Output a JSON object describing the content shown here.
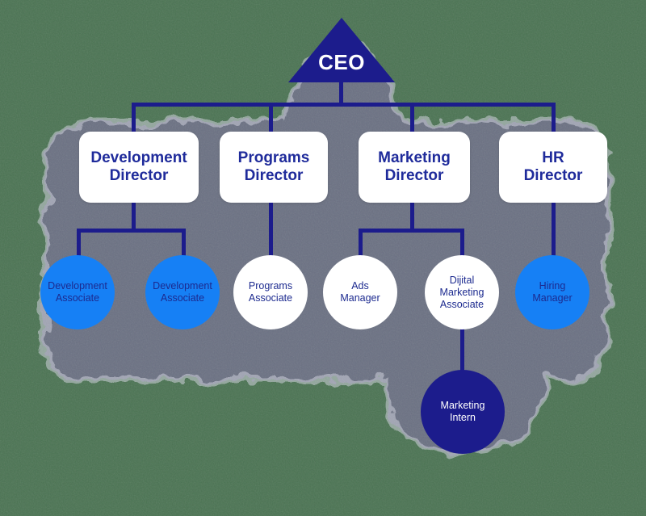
{
  "palette": {
    "navy": "#1c1c8c",
    "bright_blue": "#1680f5",
    "white": "#ffffff",
    "text_navy": "#1c2a8f",
    "background_green": "#4a7352",
    "cloud_gray": "#6d6f87"
  },
  "chart_data": {
    "type": "diagram",
    "title": "Organizational Chart",
    "nodes": [
      {
        "id": "ceo",
        "label": "CEO",
        "shape": "triangle",
        "fill": "#1c1c8c",
        "text_color": "#ffffff",
        "level": 0
      },
      {
        "id": "dev_dir",
        "label": "Development\nDirector",
        "shape": "rounded-rect",
        "fill": "#ffffff",
        "text_color": "#1f2b9b",
        "level": 1
      },
      {
        "id": "prog_dir",
        "label": "Programs\nDirector",
        "shape": "rounded-rect",
        "fill": "#ffffff",
        "text_color": "#1f2b9b",
        "level": 1
      },
      {
        "id": "mkt_dir",
        "label": "Marketing\nDirector",
        "shape": "rounded-rect",
        "fill": "#ffffff",
        "text_color": "#1f2b9b",
        "level": 1
      },
      {
        "id": "hr_dir",
        "label": "HR\nDirector",
        "shape": "rounded-rect",
        "fill": "#ffffff",
        "text_color": "#1f2b9b",
        "level": 1
      },
      {
        "id": "dev_a1",
        "label": "Development\nAssociate",
        "shape": "circle",
        "fill": "#1680f5",
        "text_color": "#1c2a8f",
        "level": 2
      },
      {
        "id": "dev_a2",
        "label": "Development\nAssociate",
        "shape": "circle",
        "fill": "#1680f5",
        "text_color": "#1c2a8f",
        "level": 2
      },
      {
        "id": "prog_a",
        "label": "Programs\nAssociate",
        "shape": "circle",
        "fill": "#ffffff",
        "text_color": "#1c2a8f",
        "level": 2
      },
      {
        "id": "ads_mgr",
        "label": "Ads\nManager",
        "shape": "circle",
        "fill": "#ffffff",
        "text_color": "#1c2a8f",
        "level": 2
      },
      {
        "id": "dij_mkt",
        "label": "Dijital\nMarketing\nAssociate",
        "shape": "circle",
        "fill": "#ffffff",
        "text_color": "#1c2a8f",
        "level": 2
      },
      {
        "id": "hire_mgr",
        "label": "Hiring\nManager",
        "shape": "circle",
        "fill": "#1680f5",
        "text_color": "#1c2a8f",
        "level": 2
      },
      {
        "id": "mkt_intern",
        "label": "Marketing\nIntern",
        "shape": "circle",
        "fill": "#1c1c8c",
        "text_color": "#ffffff",
        "level": 3
      }
    ],
    "edges": [
      {
        "from": "ceo",
        "to": "dev_dir"
      },
      {
        "from": "ceo",
        "to": "prog_dir"
      },
      {
        "from": "ceo",
        "to": "mkt_dir"
      },
      {
        "from": "ceo",
        "to": "hr_dir"
      },
      {
        "from": "dev_dir",
        "to": "dev_a1"
      },
      {
        "from": "dev_dir",
        "to": "dev_a2"
      },
      {
        "from": "prog_dir",
        "to": "prog_a"
      },
      {
        "from": "mkt_dir",
        "to": "ads_mgr"
      },
      {
        "from": "mkt_dir",
        "to": "dij_mkt"
      },
      {
        "from": "hr_dir",
        "to": "hire_mgr"
      },
      {
        "from": "dij_mkt",
        "to": "mkt_intern"
      }
    ]
  },
  "ceo": {
    "label": "CEO"
  },
  "directors": [
    {
      "label": "Development\nDirector"
    },
    {
      "label": "Programs\nDirector"
    },
    {
      "label": "Marketing\nDirector"
    },
    {
      "label": "HR\nDirector"
    }
  ],
  "associates": [
    {
      "label": "Development\nAssociate"
    },
    {
      "label": "Development\nAssociate"
    },
    {
      "label": "Programs\nAssociate"
    },
    {
      "label": "Ads\nManager"
    },
    {
      "label": "Dijital\nMarketing\nAssociate"
    },
    {
      "label": "Hiring\nManager"
    }
  ],
  "intern": {
    "label": "Marketing\nIntern"
  }
}
